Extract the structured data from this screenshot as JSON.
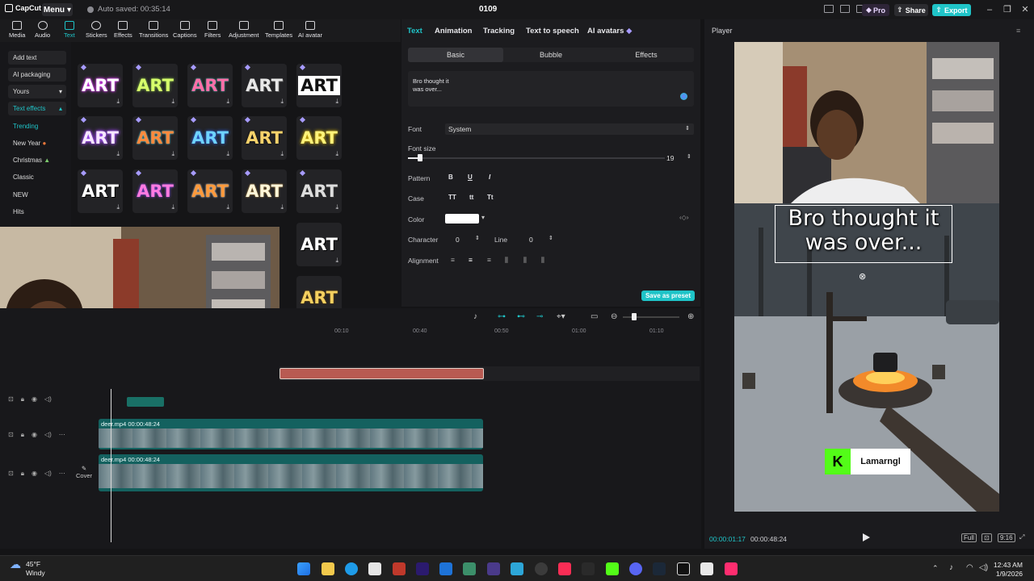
{
  "titlebar": {
    "logo": "CapCut",
    "menu": "Menu",
    "autosave": "Auto saved: 00:35:14",
    "project_title": "0109",
    "pro": "Pro",
    "share": "Share",
    "export": "Export",
    "accent_color": "#1fc4c8"
  },
  "toolbar": {
    "items": [
      "Media",
      "Audio",
      "Text",
      "Stickers",
      "Effects",
      "Transitions",
      "Captions",
      "Filters",
      "Adjustment",
      "Templates",
      "AI avatar"
    ],
    "active": "Text"
  },
  "sidebar": {
    "items": [
      "Add text",
      "AI packaging",
      "Yours",
      "Text effects",
      "Trending",
      "New Year",
      "Christmas",
      "Classic",
      "NEW",
      "Hits"
    ],
    "selected": "Trending"
  },
  "effects": {
    "tile_text": "ART"
  },
  "properties": {
    "tabs": [
      "Text",
      "Animation",
      "Tracking",
      "Text to speech",
      "AI avatars"
    ],
    "active_tab": "Text",
    "subtabs": [
      "Basic",
      "Bubble",
      "Effects"
    ],
    "active_subtab": "Basic",
    "text_line1": "Bro thought it",
    "text_line2": "was over...",
    "font_label": "Font",
    "font_value": "System",
    "font_size_label": "Font size",
    "font_size_value": "19",
    "pattern_label": "Pattern",
    "pattern_b": "B",
    "pattern_u": "U",
    "pattern_i": "I",
    "case_label": "Case",
    "case_upper": "TT",
    "case_lower": "tt",
    "case_title": "Tt",
    "color_label": "Color",
    "character_label": "Character",
    "character_value": "0",
    "line_label": "Line",
    "line_value": "0",
    "alignment_label": "Alignment",
    "save_preset": "Save as preset"
  },
  "player": {
    "title": "Player",
    "caption_line1": "Bro thought it",
    "caption_line2": "was over...",
    "kick_logo": "K",
    "kick_name": "Lamarngl",
    "time_current": "00:00:01:17",
    "time_total": "00:00:48:24",
    "full_label": "Full",
    "ratio_label": "9:16"
  },
  "timeline": {
    "ruler": [
      "00:10",
      "00:40",
      "00:50",
      "01:00",
      "01:10"
    ],
    "clip1_label": "deer.mp4  00:00:48:24",
    "clip2_label": "deer.mp4  00:00:48:24",
    "cover_label": "Cover"
  },
  "taskbar": {
    "temp": "45°F",
    "weather": "Windy",
    "time": "12:43 AM",
    "date": "1/9/2026"
  }
}
